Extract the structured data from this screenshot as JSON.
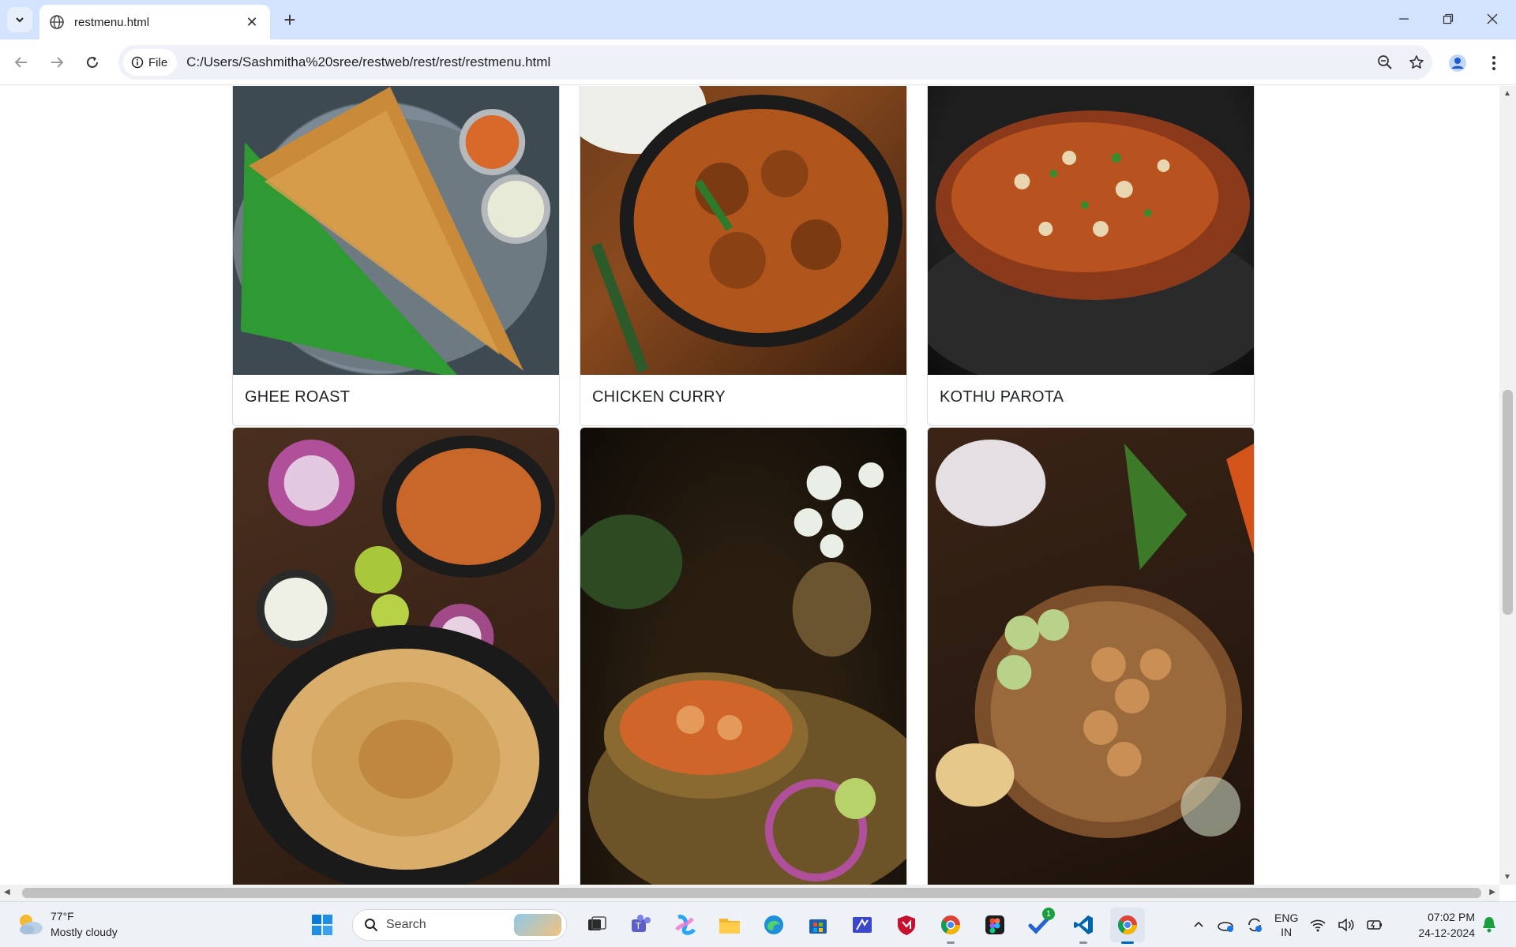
{
  "browser": {
    "tab_title": "restmenu.html",
    "new_tab_symbol": "+",
    "close_tab_symbol": "✕",
    "site_chip_label": "File",
    "url": "C:/Users/Sashmitha%20sree/restweb/rest/rest/restmenu.html",
    "icons": [
      "tab-search-icon",
      "globe-icon",
      "back-icon",
      "forward-icon",
      "reload-icon",
      "info-icon",
      "zoom-icon",
      "star-icon",
      "profile-icon",
      "kebab-menu-icon",
      "minimize-icon",
      "maximize-icon",
      "close-icon"
    ]
  },
  "menu": {
    "items": [
      {
        "name": "GHEE ROAST"
      },
      {
        "name": "CHICKEN CURRY"
      },
      {
        "name": "KOTHU PAROTA"
      },
      {
        "name": ""
      },
      {
        "name": ""
      },
      {
        "name": ""
      }
    ]
  },
  "taskbar": {
    "weather_temp": "77°F",
    "weather_desc": "Mostly cloudy",
    "search_label": "Search",
    "lang_top": "ENG",
    "lang_bottom": "IN",
    "time": "07:02 PM",
    "date": "24-12-2024",
    "todo_badge": "1",
    "apps": [
      "windows-start-icon",
      "task-view-icon",
      "teams-icon",
      "copilot-icon",
      "file-explorer-icon",
      "edge-icon",
      "store-icon",
      "code-studio-icon",
      "mcafee-icon",
      "chrome-icon",
      "figma-icon",
      "todo-icon",
      "vscode-icon",
      "chrome-active-icon"
    ],
    "accent_color": "#0067c0"
  }
}
